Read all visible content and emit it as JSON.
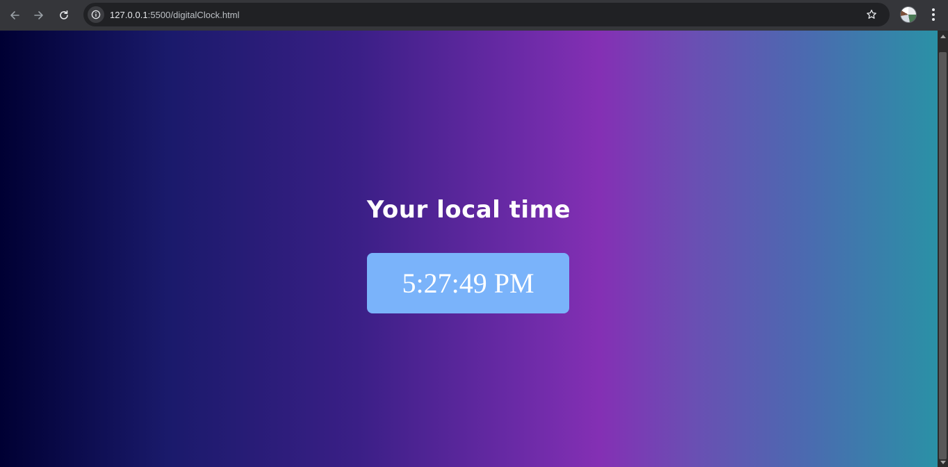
{
  "browser": {
    "url_host": "127.0.0.1",
    "url_rest": ":5500/digitalClock.html",
    "icons": {
      "back": "back-arrow-icon",
      "forward": "forward-arrow-icon",
      "reload": "reload-icon",
      "site_info": "info-icon",
      "bookmark": "star-icon",
      "profile": "avatar",
      "menu": "kebab-menu-icon"
    }
  },
  "page": {
    "heading": "Your local time",
    "time": "5:27:49 PM",
    "colors": {
      "gradient": [
        "#000033",
        "#1a1a6b",
        "#3a1f86",
        "#6a2aa6",
        "#8430b4",
        "#6a4fb3",
        "#4b6ab0",
        "#2a91a6"
      ],
      "clock_box": "#7ab3fa",
      "text": "#ffffff"
    }
  }
}
